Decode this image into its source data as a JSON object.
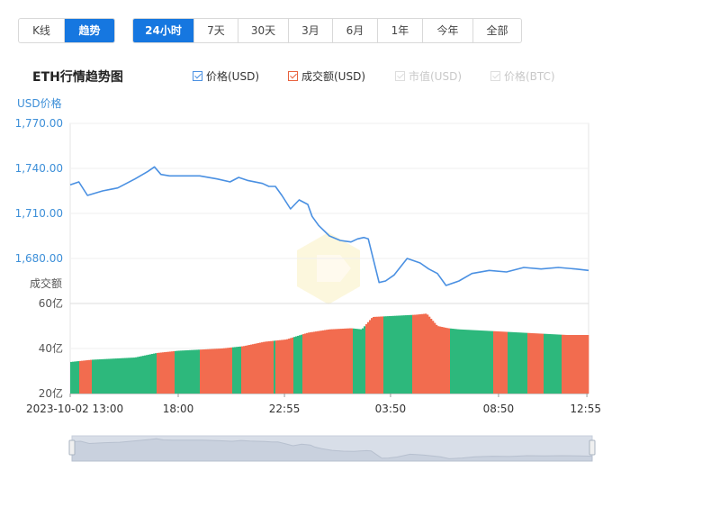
{
  "view_tabs": [
    {
      "label": "K线",
      "active": false
    },
    {
      "label": "趋势",
      "active": true
    }
  ],
  "range_tabs": [
    {
      "label": "24小时",
      "active": true
    },
    {
      "label": "7天",
      "active": false
    },
    {
      "label": "30天",
      "active": false
    },
    {
      "label": "3月",
      "active": false
    },
    {
      "label": "6月",
      "active": false
    },
    {
      "label": "1年",
      "active": false
    },
    {
      "label": "今年",
      "active": false
    },
    {
      "label": "全部",
      "active": false
    }
  ],
  "legend": [
    {
      "label": "价格(USD)",
      "checked": true,
      "color": "#4a90e2"
    },
    {
      "label": "成交额(USD)",
      "checked": true,
      "color": "#e8613d"
    },
    {
      "label": "市值(USD)",
      "checked": false,
      "color": "#cccccc"
    },
    {
      "label": "价格(BTC)",
      "checked": false,
      "color": "#cccccc"
    }
  ],
  "chart_data": {
    "type": "line",
    "title": "ETH行情趋势图",
    "price_axis_label": "USD价格",
    "price_ticks": [
      "1,770.00",
      "1,740.00",
      "1,710.00",
      "1,680.00"
    ],
    "price_ylim": [
      1680,
      1770
    ],
    "volume_axis_label": "成交额",
    "volume_ticks": [
      "60亿",
      "40亿",
      "20亿"
    ],
    "volume_ylim": [
      20,
      60
    ],
    "x_ticks": [
      "2023-10-02 13:00",
      "18:00",
      "22:55",
      "03:50",
      "08:50",
      "12:55"
    ],
    "x_tick_hours": [
      0,
      5,
      9.92,
      14.83,
      19.83,
      23.92
    ],
    "x_range_hours": [
      0,
      24
    ],
    "price_series": {
      "name": "价格(USD)",
      "color": "#4a90e2",
      "hours": [
        0,
        0.4,
        0.8,
        1.5,
        2.2,
        3.0,
        3.6,
        3.9,
        4.2,
        4.6,
        5.0,
        6.0,
        6.8,
        7.4,
        7.8,
        8.2,
        8.9,
        9.2,
        9.5,
        9.8,
        10.2,
        10.6,
        11.0,
        11.2,
        11.5,
        12.0,
        12.5,
        13.0,
        13.3,
        13.6,
        13.8,
        14.3,
        14.6,
        15.0,
        15.6,
        16.2,
        16.6,
        17.0,
        17.4,
        18.0,
        18.6,
        19.4,
        20.2,
        21.0,
        21.8,
        22.6,
        23.4,
        24.0
      ],
      "values": [
        1729,
        1731,
        1722,
        1725,
        1727,
        1733,
        1738,
        1741,
        1736,
        1735,
        1735,
        1735,
        1733,
        1731,
        1734,
        1732,
        1730,
        1728,
        1728,
        1722,
        1713,
        1719,
        1716,
        1708,
        1702,
        1695,
        1692,
        1691,
        1693,
        1694,
        1693,
        1664,
        1665,
        1669,
        1680,
        1677,
        1673,
        1670,
        1662,
        1665,
        1670,
        1672,
        1671,
        1674,
        1673,
        1674,
        1673,
        1672
      ]
    },
    "volume_series": {
      "name": "成交额(USD)",
      "up_color": "#2db87c",
      "down_color": "#f26c4f",
      "hours": [
        0,
        1,
        2,
        3,
        4,
        5,
        6,
        7,
        8,
        9,
        10,
        11,
        12,
        13,
        13.5,
        14,
        15,
        16,
        16.5,
        17,
        17.5,
        18,
        19,
        20,
        21,
        22,
        23,
        24
      ],
      "values": [
        34,
        35,
        35.5,
        36,
        38,
        39,
        39.5,
        40,
        41,
        43,
        44,
        47,
        48.5,
        49,
        48.5,
        54,
        54.5,
        55,
        55.5,
        50,
        49,
        48.5,
        48,
        47.5,
        47,
        46.5,
        46,
        46
      ]
    }
  }
}
